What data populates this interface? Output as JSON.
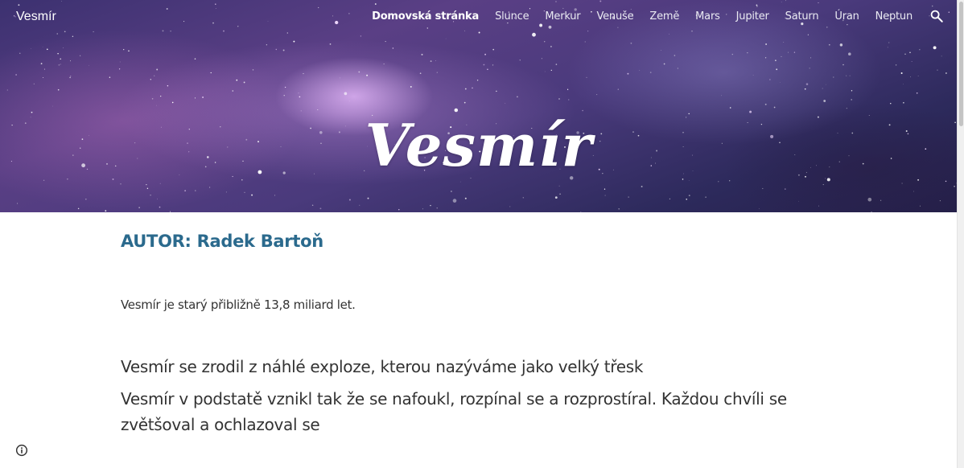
{
  "site": {
    "name": "Vesmír"
  },
  "nav": {
    "items": [
      {
        "label": "Domovská stránka",
        "active": true
      },
      {
        "label": "Slunce",
        "active": false
      },
      {
        "label": "Merkur",
        "active": false
      },
      {
        "label": "Venuše",
        "active": false
      },
      {
        "label": "Země",
        "active": false
      },
      {
        "label": "Mars",
        "active": false
      },
      {
        "label": "Jupiter",
        "active": false
      },
      {
        "label": "Saturn",
        "active": false
      },
      {
        "label": "Úran",
        "active": false
      },
      {
        "label": "Neptun",
        "active": false
      }
    ],
    "search_icon": "search-icon"
  },
  "hero": {
    "title": "Vesmír"
  },
  "content": {
    "author": "AUTOR: Radek Bartoň",
    "paragraph_small": "Vesmír je starý přibližně 13,8 miliard let.",
    "paragraph_1": "Vesmír se zrodil z náhlé exploze, kterou nazýváme jako velký třesk",
    "paragraph_2": "Vesmír v podstatě vznikl tak že se nafoukl, rozpínal se a rozprostíral. Každou chvíli se zvětšoval a ochlazoval se"
  },
  "footer": {
    "info_icon": "info-icon"
  },
  "colors": {
    "link_heading": "#2b6a8d",
    "body_text": "#333333"
  }
}
